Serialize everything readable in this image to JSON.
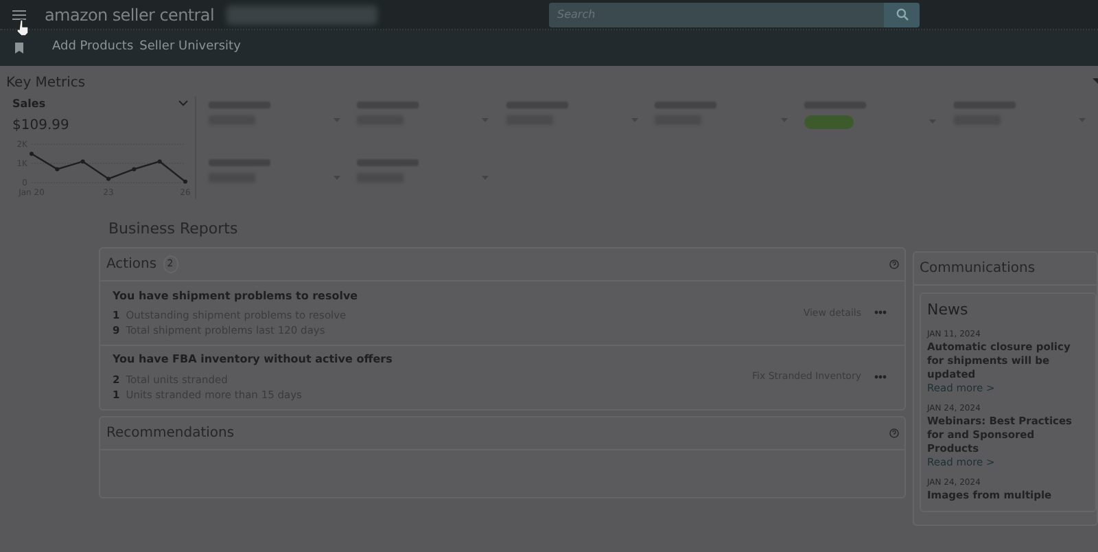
{
  "header": {
    "logo": "amazon seller central",
    "search": {
      "placeholder": "Search"
    }
  },
  "nav": {
    "links": [
      "Add Products",
      "Seller University"
    ]
  },
  "key_metrics": {
    "title": "Key Metrics",
    "sales": {
      "label": "Sales",
      "value": "$109.99",
      "chart_data": {
        "type": "line",
        "x": [
          20,
          21,
          22,
          23,
          24,
          25,
          26
        ],
        "xlim": [
          20,
          26
        ],
        "xticks": [
          {
            "value": 20,
            "label": "Jan 20"
          },
          {
            "value": 23,
            "label": "23"
          },
          {
            "value": 26,
            "label": "26"
          }
        ],
        "yticks": [
          {
            "value": 0,
            "label": "0"
          },
          {
            "value": 1000,
            "label": "1K"
          },
          {
            "value": 2000,
            "label": "2K"
          }
        ],
        "ylim": [
          0,
          2000
        ],
        "series": [
          {
            "color": "#1e1e1e",
            "marker": true,
            "values": [
              1500,
              700,
              1100,
              200,
              700,
              1100,
              50
            ]
          }
        ]
      }
    },
    "metrics": [
      {
        "kind": "text"
      },
      {
        "kind": "text"
      },
      {
        "kind": "text"
      },
      {
        "kind": "text"
      },
      {
        "kind": "pill"
      },
      {
        "kind": "text"
      },
      {
        "kind": "text"
      },
      {
        "kind": "text"
      }
    ]
  },
  "business_reports": {
    "title": "Business Reports"
  },
  "actions": {
    "title": "Actions",
    "count": "2",
    "items": [
      {
        "title": "You have shipment problems to resolve",
        "link": "View details",
        "lines": [
          {
            "count": "1",
            "text": "Outstanding shipment problems to resolve"
          },
          {
            "count": "9",
            "text": "Total shipment problems last 120 days"
          }
        ]
      },
      {
        "title": "You have FBA inventory without active offers",
        "link": "Fix Stranded Inventory",
        "lines": [
          {
            "count": "2",
            "text": "Total units stranded"
          },
          {
            "count": "1",
            "text": "Units stranded more than 15 days"
          }
        ]
      }
    ]
  },
  "recommendations": {
    "title": "Recommendations"
  },
  "communications": {
    "title": "Communications",
    "news_title": "News",
    "news": [
      {
        "date": "JAN 11, 2024",
        "title": "Automatic closure policy for shipments will be updated",
        "link": "Read more >"
      },
      {
        "date": "JAN 24, 2024",
        "title": "Webinars: Best Practices for and Sponsored Products",
        "link": "Read more >"
      },
      {
        "date": "JAN 24, 2024",
        "title": "Images from multiple"
      }
    ]
  }
}
